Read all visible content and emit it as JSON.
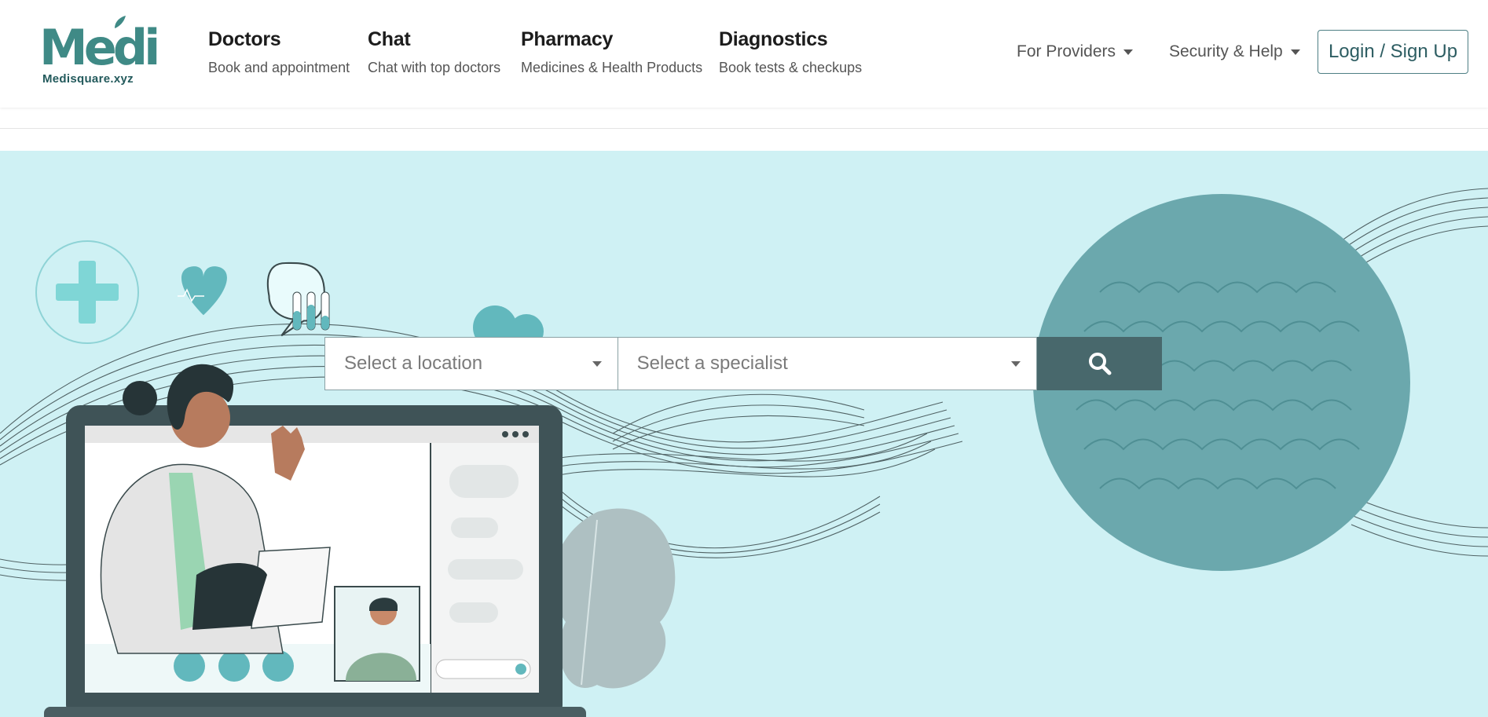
{
  "brand": {
    "logo_word": "Medi",
    "logo_sub": "Medisquare.xyz"
  },
  "nav": [
    {
      "title": "Doctors",
      "subtitle": "Book and appointment"
    },
    {
      "title": "Chat",
      "subtitle": "Chat with top doctors"
    },
    {
      "title": "Pharmacy",
      "subtitle": "Medicines & Health Products"
    },
    {
      "title": "Diagnostics",
      "subtitle": "Book tests & checkups"
    }
  ],
  "menus": {
    "providers": "For Providers",
    "security": "Security & Help",
    "login": "Login / Sign Up"
  },
  "search": {
    "location_placeholder": "Select a location",
    "specialist_placeholder": "Select a specialist",
    "button_icon": "search-icon"
  },
  "colors": {
    "hero_bg": "#cff1f4",
    "brand_teal": "#3f8a86",
    "search_button": "#48686c",
    "circle": "#6ba8ad"
  }
}
